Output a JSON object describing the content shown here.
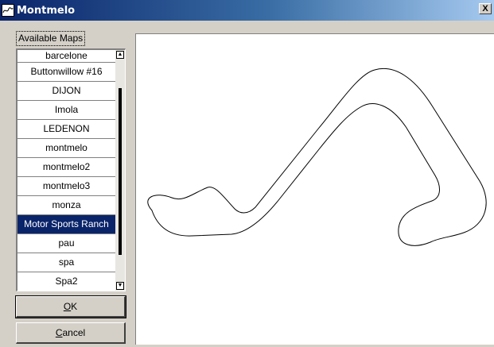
{
  "window": {
    "title": "Montmelo",
    "close_label": "X"
  },
  "maps": {
    "label": "Available Maps",
    "items": [
      {
        "label": "barcelone",
        "selected": false
      },
      {
        "label": "Buttonwillow #16",
        "selected": false
      },
      {
        "label": "DIJON",
        "selected": false
      },
      {
        "label": "Imola",
        "selected": false
      },
      {
        "label": "LEDENON",
        "selected": false
      },
      {
        "label": "montmelo",
        "selected": false
      },
      {
        "label": "montmelo2",
        "selected": false
      },
      {
        "label": "montmelo3",
        "selected": false
      },
      {
        "label": "monza",
        "selected": false
      },
      {
        "label": "Motor Sports Ranch",
        "selected": true
      },
      {
        "label": "pau",
        "selected": false
      },
      {
        "label": "spa",
        "selected": false
      },
      {
        "label": "Spa2",
        "selected": false
      }
    ]
  },
  "buttons": {
    "ok_label": "OK",
    "ok_mnemonic": "O",
    "cancel_label": "Cancel",
    "cancel_mnemonic": "C"
  },
  "colors": {
    "selection_bg": "#0a246a",
    "selection_fg": "#ffffff",
    "track_stroke": "#000000"
  },
  "icons": {
    "app": "track-map-icon",
    "close": "close-icon",
    "scroll_up": "scroll-up-arrow-icon",
    "scroll_down": "scroll-down-arrow-icon"
  }
}
